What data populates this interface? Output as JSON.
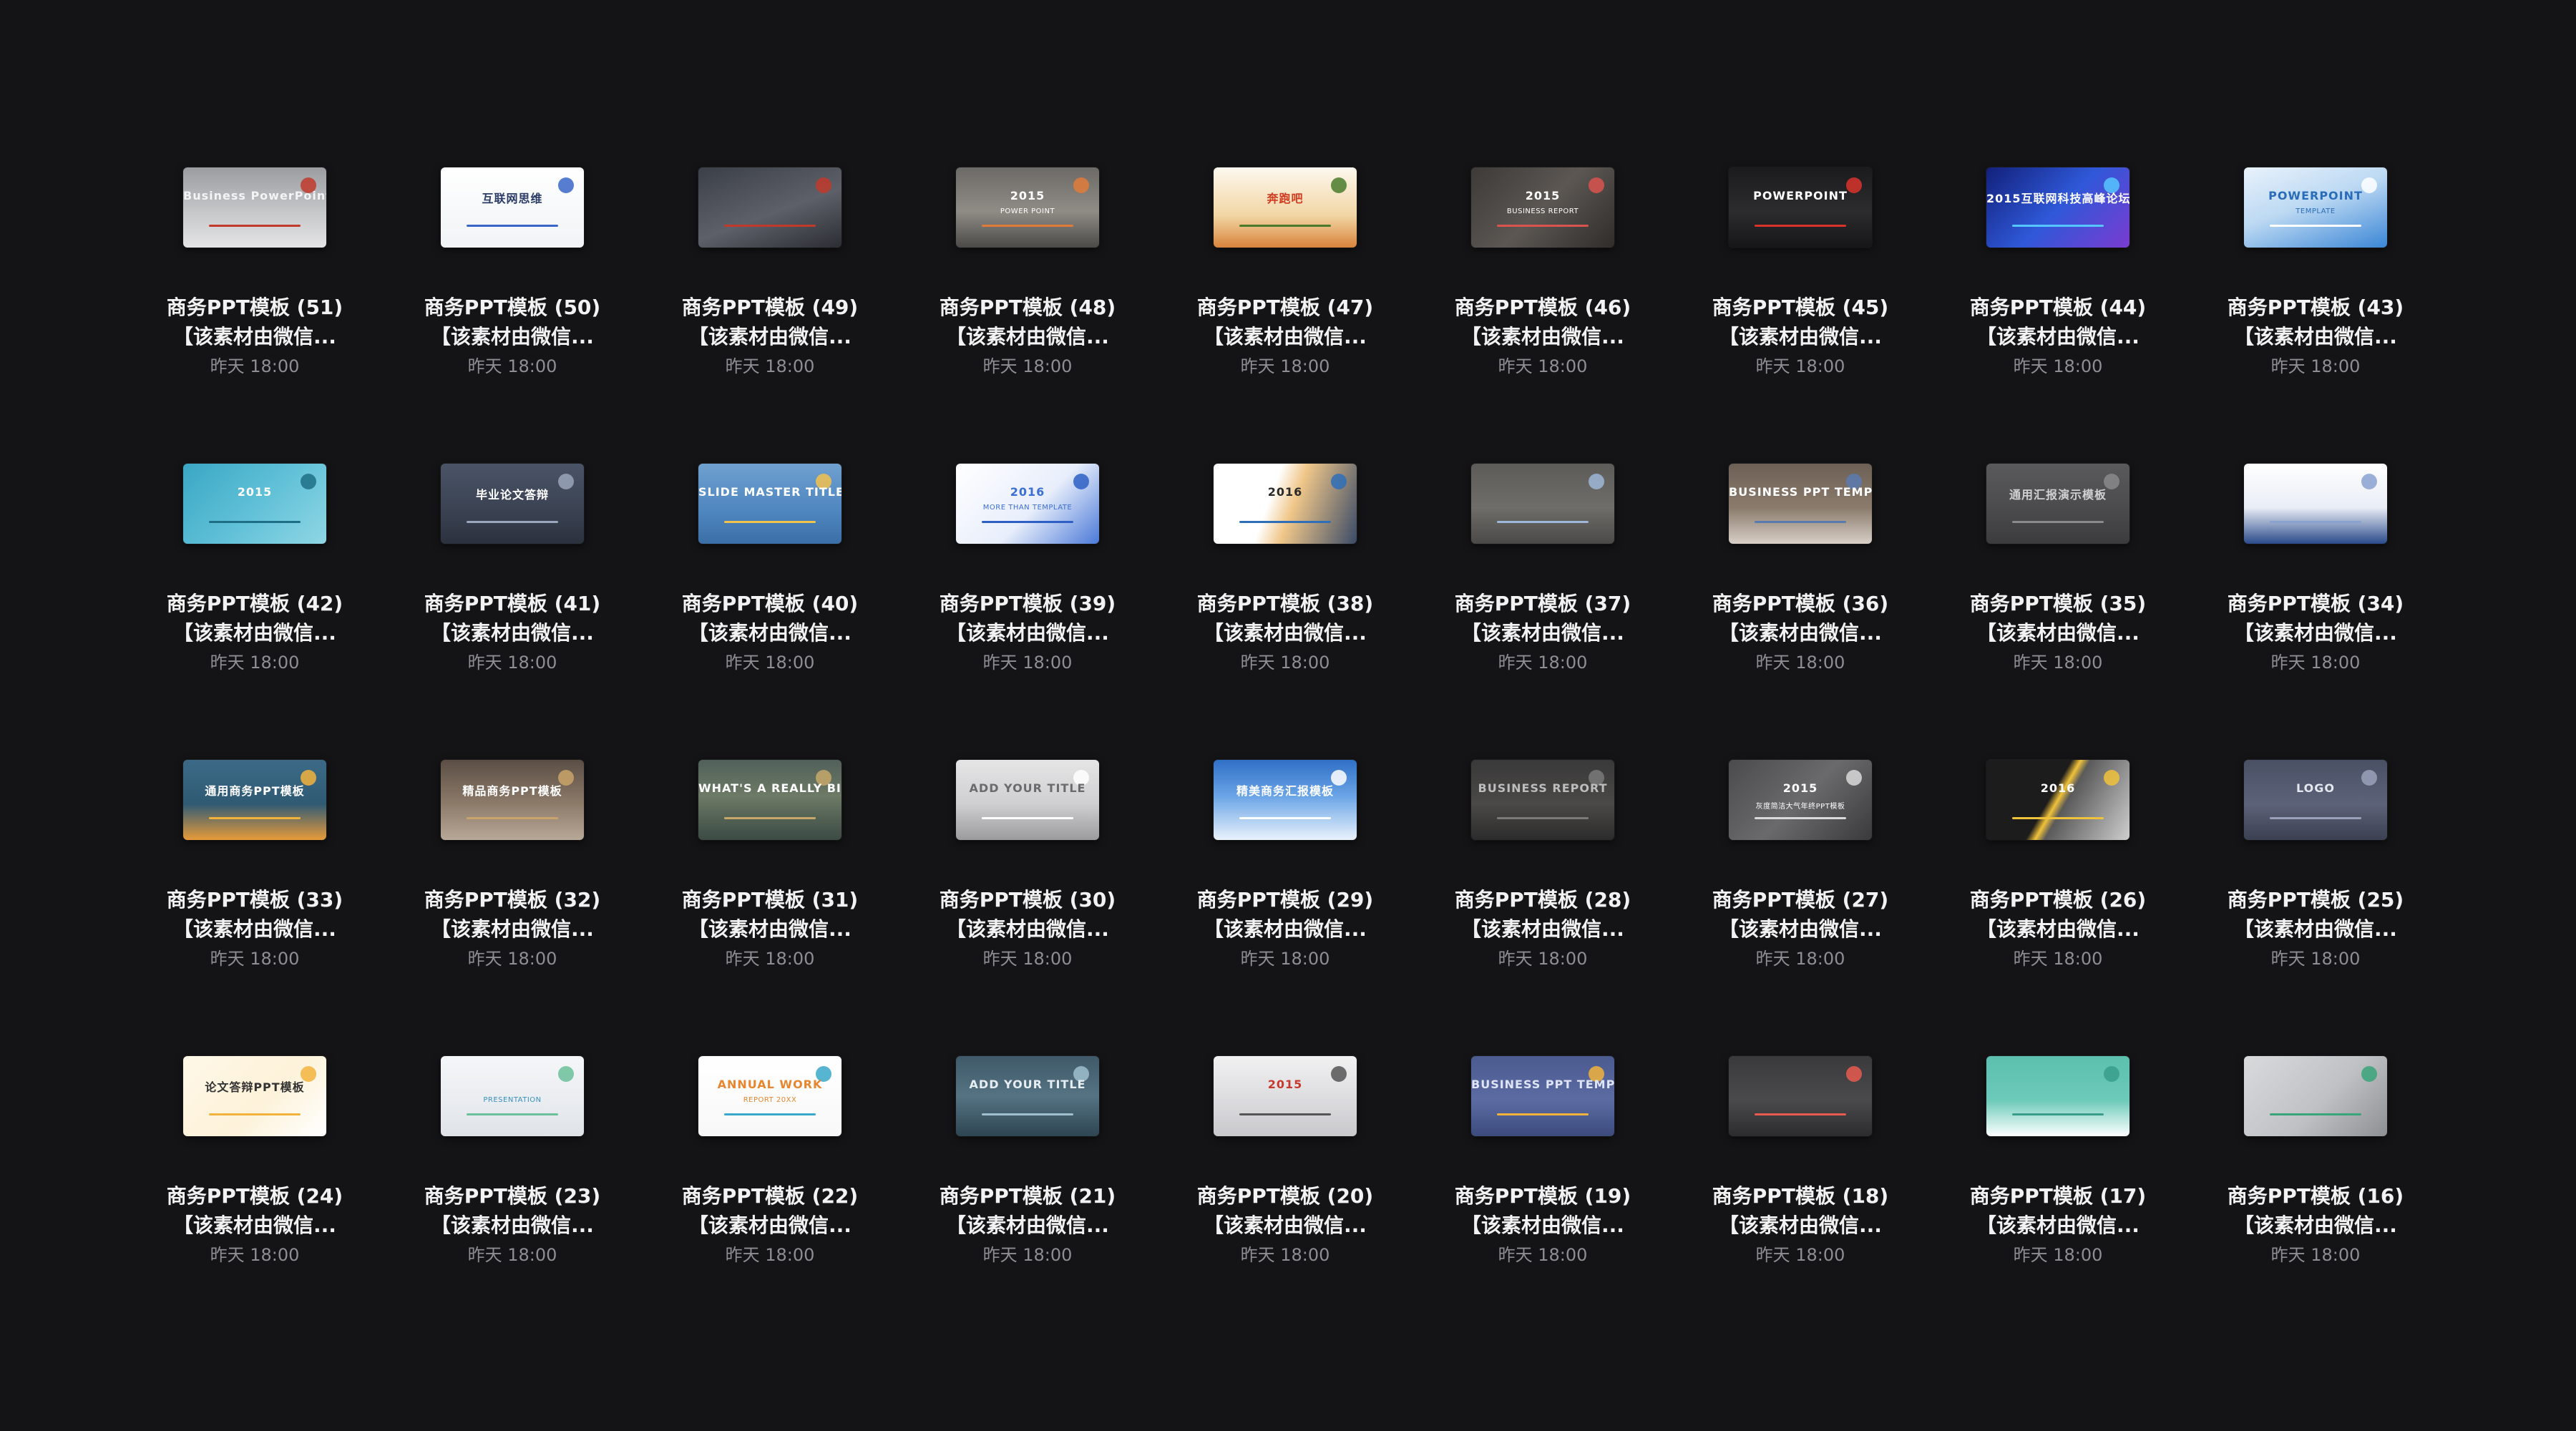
{
  "files": [
    {
      "name": "商务PPT模板 (51)",
      "desc": "【该素材由微信...",
      "date": "昨天 18:00",
      "thumb": {
        "bg": "linear-gradient(180deg,#9a9ca0,#c9cacc 60%,#e4e4e6)",
        "fg": "#f4f4f5",
        "accent": "#c0392b",
        "text": "Business PowerPoint Template",
        "sub": ""
      }
    },
    {
      "name": "商务PPT模板 (50)",
      "desc": "【该素材由微信...",
      "date": "昨天 18:00",
      "thumb": {
        "bg": "linear-gradient(180deg,#ffffff,#f1f3f6)",
        "fg": "#2a3b66",
        "accent": "#3a66c8",
        "text": "互联网思维",
        "sub": ""
      }
    },
    {
      "name": "商务PPT模板 (49)",
      "desc": "【该素材由微信...",
      "date": "昨天 18:00",
      "thumb": {
        "bg": "linear-gradient(160deg,#3b3f47,#5d6068 55%,#2b2d33)",
        "fg": "#d9dbe0",
        "accent": "#c0392b",
        "text": "",
        "sub": ""
      }
    },
    {
      "name": "商务PPT模板 (48)",
      "desc": "【该素材由微信...",
      "date": "昨天 18:00",
      "thumb": {
        "bg": "linear-gradient(180deg,#6c6a66,#8f8c86 55%,#4b4a47)",
        "fg": "#ffffff",
        "accent": "#e07b39",
        "text": "2015",
        "sub": "POWER POINT"
      }
    },
    {
      "name": "商务PPT模板 (47)",
      "desc": "【该素材由微信...",
      "date": "昨天 18:00",
      "thumb": {
        "bg": "linear-gradient(180deg,#fdf8ef,#f2d6a4 60%,#d8833b)",
        "fg": "#d03a1f",
        "accent": "#4a7b2c",
        "text": "奔跑吧",
        "sub": ""
      }
    },
    {
      "name": "商务PPT模板 (46)",
      "desc": "【该素材由微信...",
      "date": "昨天 18:00",
      "thumb": {
        "bg": "linear-gradient(135deg,#3d3a38,#5c5753 50%,#2f2c2a)",
        "fg": "#ffffff",
        "accent": "#d9534f",
        "text": "2015",
        "sub": "BUSINESS REPORT"
      }
    },
    {
      "name": "商务PPT模板 (45)",
      "desc": "【该素材由微信...",
      "date": "昨天 18:00",
      "thumb": {
        "bg": "linear-gradient(180deg,#1b1b1d,#2c2c2f 55%,#161618)",
        "fg": "#ffffff",
        "accent": "#d9342b",
        "text": "POWERPOINT",
        "sub": ""
      }
    },
    {
      "name": "商务PPT模板 (44)",
      "desc": "【该素材由微信...",
      "date": "昨天 18:00",
      "thumb": {
        "bg": "linear-gradient(135deg,#12207a,#2f58d8 50%,#7a3bd1)",
        "fg": "#ffffff",
        "accent": "#56c6ff",
        "text": "2015互联网科技高峰论坛",
        "sub": ""
      }
    },
    {
      "name": "商务PPT模板 (43)",
      "desc": "【该素材由微信...",
      "date": "昨天 18:00",
      "thumb": {
        "bg": "linear-gradient(160deg,#e9f2fb,#bcd9f3 45%,#3b86d6)",
        "fg": "#2a6cb8",
        "accent": "#ffffff",
        "text": "POWERPOINT",
        "sub": "TEMPLATE"
      }
    },
    {
      "name": "商务PPT模板 (42)",
      "desc": "【该素材由微信...",
      "date": "昨天 18:00",
      "thumb": {
        "bg": "linear-gradient(135deg,#3aa7c4,#5fc0d7 50%,#8fd6e4)",
        "fg": "#ffffff",
        "accent": "#1e6f86",
        "text": "2015",
        "sub": ""
      }
    },
    {
      "name": "商务PPT模板 (41)",
      "desc": "【该素材由微信...",
      "date": "昨天 18:00",
      "thumb": {
        "bg": "linear-gradient(180deg,#4a5466,#3a4252 60%,#2b313d)",
        "fg": "#ffffff",
        "accent": "#9aa6bb",
        "text": "毕业论文答辩",
        "sub": ""
      }
    },
    {
      "name": "商务PPT模板 (40)",
      "desc": "【该素材由微信...",
      "date": "昨天 18:00",
      "thumb": {
        "bg": "linear-gradient(180deg,#6fa0cf,#4e86bf 60%,#3b6ea6)",
        "fg": "#ffffff",
        "accent": "#f2c14e",
        "text": "SLIDE MASTER TITLE HERE",
        "sub": ""
      }
    },
    {
      "name": "商务PPT模板 (39)",
      "desc": "【该素材由微信...",
      "date": "昨天 18:00",
      "thumb": {
        "bg": "linear-gradient(135deg,#ffffff,#e8eefb 55%,#4a79d8)",
        "fg": "#3c6fd2",
        "accent": "#2d5fc4",
        "text": "2016",
        "sub": "MORE THAN TEMPLATE"
      }
    },
    {
      "name": "商务PPT模板 (38)",
      "desc": "【该素材由微信...",
      "date": "昨天 18:00",
      "thumb": {
        "bg": "linear-gradient(110deg,#ffffff 40%,#f0c78a 55%,#3a4a66)",
        "fg": "#2a2a2a",
        "accent": "#2f6fb8",
        "text": "2016",
        "sub": ""
      }
    },
    {
      "name": "商务PPT模板 (37)",
      "desc": "【该素材由微信...",
      "date": "昨天 18:00",
      "thumb": {
        "bg": "linear-gradient(180deg,#5d5c59,#6f6d69 55%,#4a4947)",
        "fg": "#e6b33c",
        "accent": "#9fb7d8",
        "text": "",
        "sub": ""
      }
    },
    {
      "name": "商务PPT模板 (36)",
      "desc": "【该素材由微信...",
      "date": "昨天 18:00",
      "thumb": {
        "bg": "linear-gradient(180deg,#6d6055,#8a7b6c 55%,#d8cfc7)",
        "fg": "#ffffff",
        "accent": "#5a7bb0",
        "text": "BUSINESS PPT TEMPLATE",
        "sub": ""
      }
    },
    {
      "name": "商务PPT模板 (35)",
      "desc": "【该素材由微信...",
      "date": "昨天 18:00",
      "thumb": {
        "bg": "linear-gradient(180deg,#5a5a5c,#4a4a4c 60%,#3b3b3d)",
        "fg": "#d0d0d2",
        "accent": "#8a8a8c",
        "text": "通用汇报演示模板",
        "sub": ""
      }
    },
    {
      "name": "商务PPT模板 (34)",
      "desc": "【该素材由微信...",
      "date": "昨天 18:00",
      "thumb": {
        "bg": "linear-gradient(180deg,#ffffff,#e9edf6 55%,#2a4a8a)",
        "fg": "#2a4a8a",
        "accent": "#8aa2d0",
        "text": "",
        "sub": ""
      }
    },
    {
      "name": "商务PPT模板 (33)",
      "desc": "【该素材由微信...",
      "date": "昨天 18:00",
      "thumb": {
        "bg": "linear-gradient(180deg,#3c6a86,#2f5a74 55%,#e89b3a)",
        "fg": "#ffffff",
        "accent": "#f2b33d",
        "text": "通用商务PPT模板",
        "sub": ""
      }
    },
    {
      "name": "商务PPT模板 (32)",
      "desc": "【该素材由微信...",
      "date": "昨天 18:00",
      "thumb": {
        "bg": "linear-gradient(180deg,#5a4e44,#8d7b6a 55%,#b8a898)",
        "fg": "#ffffff",
        "accent": "#c9a46a",
        "text": "精品商务PPT模板",
        "sub": ""
      }
    },
    {
      "name": "商务PPT模板 (31)",
      "desc": "【该素材由微信...",
      "date": "昨天 18:00",
      "thumb": {
        "bg": "linear-gradient(180deg,#51605a,#6d7a66 45%,#3b4a44)",
        "fg": "#ffffff",
        "accent": "#c7a86a",
        "text": "WHAT'S A REALLY BIG HEADING",
        "sub": ""
      }
    },
    {
      "name": "商务PPT模板 (30)",
      "desc": "【该素材由微信...",
      "date": "昨天 18:00",
      "thumb": {
        "bg": "linear-gradient(180deg,#e5e5e6,#cfcfd1 55%,#9b9b9d)",
        "fg": "#6b6b6d",
        "accent": "#ffffff",
        "text": "ADD YOUR TITLE",
        "sub": ""
      }
    },
    {
      "name": "商务PPT模板 (29)",
      "desc": "【该素材由微信...",
      "date": "昨天 18:00",
      "thumb": {
        "bg": "linear-gradient(180deg,#2f6fc6,#6aa4e6 45%,#e9f2fc)",
        "fg": "#ffffff",
        "accent": "#ffffff",
        "text": "精美商务汇报模板",
        "sub": ""
      }
    },
    {
      "name": "商务PPT模板 (28)",
      "desc": "【该素材由微信...",
      "date": "昨天 18:00",
      "thumb": {
        "bg": "linear-gradient(180deg,#3a3939,#4a4948 55%,#2c2b2b)",
        "fg": "#bdbdbd",
        "accent": "#7a7a7a",
        "text": "BUSINESS REPORT",
        "sub": ""
      }
    },
    {
      "name": "商务PPT模板 (27)",
      "desc": "【该素材由微信...",
      "date": "昨天 18:00",
      "thumb": {
        "bg": "linear-gradient(135deg,#4b4b4d,#6a6a6c 50%,#3a3a3c)",
        "fg": "#ffffff",
        "accent": "#d9d9d9",
        "text": "2015",
        "sub": "灰度简洁大气年终PPT模板"
      }
    },
    {
      "name": "商务PPT模板 (26)",
      "desc": "【该素材由微信...",
      "date": "昨天 18:00",
      "thumb": {
        "bg": "linear-gradient(120deg,#1c1c1c 45%,#f0c23b 50%,#5a5a5a 55%,#cfcfcf)",
        "fg": "#ffffff",
        "accent": "#f0c23b",
        "text": "2016",
        "sub": ""
      }
    },
    {
      "name": "商务PPT模板 (25)",
      "desc": "【该素材由微信...",
      "date": "昨天 18:00",
      "thumb": {
        "bg": "linear-gradient(180deg,#4a5064,#5c6278 55%,#3b4052)",
        "fg": "#e6e8ef",
        "accent": "#9aa2bb",
        "text": "LOGO",
        "sub": ""
      }
    },
    {
      "name": "商务PPT模板 (24)",
      "desc": "【该素材由微信...",
      "date": "昨天 18:00",
      "thumb": {
        "bg": "linear-gradient(135deg,#fff8e8,#fdf2d9 55%,#ffffff)",
        "fg": "#333333",
        "accent": "#f2b33d",
        "text": "论文答辩PPT模板",
        "sub": ""
      }
    },
    {
      "name": "商务PPT模板 (23)",
      "desc": "【该素材由微信...",
      "date": "昨天 18:00",
      "thumb": {
        "bg": "linear-gradient(180deg,#f5f6f8,#e9ecf0 60%,#dfe3e8)",
        "fg": "#3a8fb8",
        "accent": "#6bbf9a",
        "text": "",
        "sub": "PRESENTATION"
      }
    },
    {
      "name": "商务PPT模板 (22)",
      "desc": "【该素材由微信...",
      "date": "昨天 18:00",
      "thumb": {
        "bg": "linear-gradient(180deg,#ffffff,#f8f8f8)",
        "fg": "#e6862e",
        "accent": "#3aa8c9",
        "text": "ANNUAL WORK",
        "sub": "REPORT 20XX"
      }
    },
    {
      "name": "商务PPT模板 (21)",
      "desc": "【该素材由微信...",
      "date": "昨天 18:00",
      "thumb": {
        "bg": "linear-gradient(180deg,#3f5968,#557383 50%,#2e4552)",
        "fg": "#e6eef2",
        "accent": "#9fc0cf",
        "text": "ADD YOUR TITLE",
        "sub": ""
      }
    },
    {
      "name": "商务PPT模板 (20)",
      "desc": "【该素材由微信...",
      "date": "昨天 18:00",
      "thumb": {
        "bg": "linear-gradient(180deg,#f1f1f2,#dcdcdf 55%,#c9c9cc)",
        "fg": "#c43a2f",
        "accent": "#555555",
        "text": "2015",
        "sub": ""
      }
    },
    {
      "name": "商务PPT模板 (19)",
      "desc": "【该素材由微信...",
      "date": "昨天 18:00",
      "thumb": {
        "bg": "linear-gradient(180deg,#4b5a8f,#5c6ca3 55%,#3c4a7c)",
        "fg": "#dfe5f6",
        "accent": "#f2b33d",
        "text": "BUSINESS PPT TEMPLATE",
        "sub": ""
      }
    },
    {
      "name": "商务PPT模板 (18)",
      "desc": "【该素材由微信...",
      "date": "昨天 18:00",
      "thumb": {
        "bg": "linear-gradient(180deg,#3a3a3c,#4a4a4d 55%,#2c2c2e)",
        "fg": "#e8e8e8",
        "accent": "#e85a4f",
        "text": "",
        "sub": ""
      }
    },
    {
      "name": "商务PPT模板 (17)",
      "desc": "【该素材由微信...",
      "date": "昨天 18:00",
      "thumb": {
        "bg": "linear-gradient(180deg,#5cbfae,#6ccab9 55%,#ffffff)",
        "fg": "#ffffff",
        "accent": "#3a9d8c",
        "text": "",
        "sub": ""
      }
    },
    {
      "name": "商务PPT模板 (16)",
      "desc": "【该素材由微信...",
      "date": "昨天 18:00",
      "thumb": {
        "bg": "linear-gradient(135deg,#d9dadc,#bfc1c4 55%,#8e9094)",
        "fg": "#ffffff",
        "accent": "#3aa57a",
        "text": "",
        "sub": ""
      }
    }
  ]
}
